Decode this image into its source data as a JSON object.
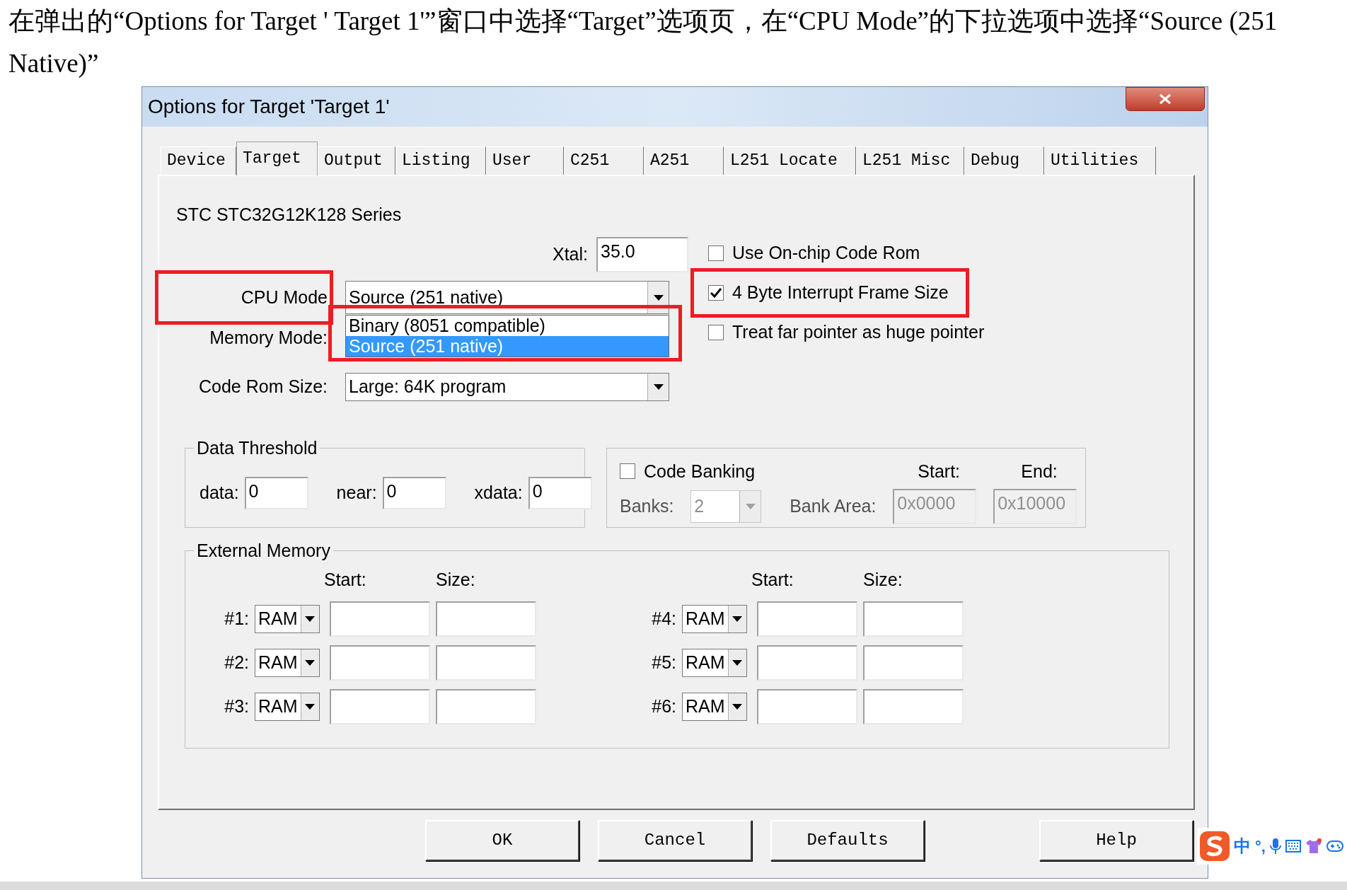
{
  "instruction": "在弹出的“Options for Target ' Target 1'”窗口中选择“Target”选项页，在“CPU Mode”的下拉选项中选择“Source (251 Native)”",
  "dialog": {
    "title": "Options for Target 'Target 1'",
    "tabs": [
      {
        "label": "Device",
        "selected": false
      },
      {
        "label": "Target",
        "selected": true
      },
      {
        "label": "Output",
        "selected": false
      },
      {
        "label": "Listing",
        "selected": false
      },
      {
        "label": "User",
        "selected": false
      },
      {
        "label": "C251",
        "selected": false
      },
      {
        "label": "A251",
        "selected": false
      },
      {
        "label": "L251 Locate",
        "selected": false
      },
      {
        "label": "L251 Misc",
        "selected": false
      },
      {
        "label": "Debug",
        "selected": false
      },
      {
        "label": "Utilities",
        "selected": false
      }
    ],
    "device": "STC STC32G12K128 Series",
    "xtal": {
      "label": "Xtal:",
      "value": "35.0"
    },
    "cpu_mode": {
      "label": "CPU Mode",
      "value": "Source (251 native)",
      "annotated": true
    },
    "memory_mode": {
      "label": "Memory Mode:"
    },
    "code_rom_size": {
      "label": "Code Rom Size:",
      "value": "Large: 64K program"
    },
    "dropdown_list": {
      "annotated": true,
      "items": [
        {
          "label": "Binary (8051 compatible)",
          "selected": false
        },
        {
          "label": "Source (251 native)",
          "selected": true
        }
      ]
    },
    "options": [
      {
        "label": "Use On-chip Code Rom",
        "checked": false,
        "annotated": false
      },
      {
        "label": "4 Byte Interrupt Frame Size",
        "checked": true,
        "annotated": true
      },
      {
        "label": "Treat far pointer as huge pointer",
        "checked": false,
        "annotated": false
      }
    ],
    "data_threshold": {
      "title": "Data Threshold",
      "fields": [
        {
          "label": "data:",
          "value": "0"
        },
        {
          "label": "near:",
          "value": "0"
        },
        {
          "label": "xdata:",
          "value": "0"
        }
      ]
    },
    "code_banking": {
      "label": "Code Banking",
      "checked": false,
      "disabled": true,
      "banks_label": "Banks:",
      "banks": "2",
      "start_header": "Start:",
      "end_header": "End:",
      "bank_area_label": "Bank Area:",
      "start": "0x0000",
      "end": "0x10000"
    },
    "external_memory": {
      "title": "External Memory",
      "columns": [
        {
          "start_header": "Start:",
          "size_header": "Size:",
          "rows": [
            {
              "label": "#1:",
              "type": "RAM"
            },
            {
              "label": "#2:",
              "type": "RAM"
            },
            {
              "label": "#3:",
              "type": "RAM"
            }
          ]
        },
        {
          "start_header": "Start:",
          "size_header": "Size:",
          "rows": [
            {
              "label": "#4:",
              "type": "RAM"
            },
            {
              "label": "#5:",
              "type": "RAM"
            },
            {
              "label": "#6:",
              "type": "RAM"
            }
          ]
        }
      ]
    },
    "buttons": [
      "OK",
      "Cancel",
      "Defaults",
      "Help"
    ]
  },
  "ime_toolbar": {
    "mode": "中",
    "punctuation": "°,"
  }
}
